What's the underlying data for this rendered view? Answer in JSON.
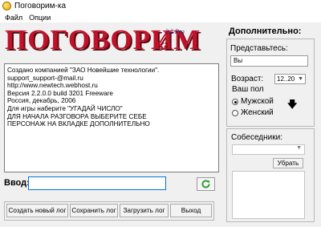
{
  "window": {
    "title": "Поговорим-ка"
  },
  "menu": {
    "items": [
      "Файл",
      "Опции"
    ]
  },
  "logo": {
    "main": "ПОГОВОРИМ",
    "suffix": "ка",
    "version": "2.2 Pro"
  },
  "chat": {
    "text": "Создано компанией \"ЗАО Новейшие технологии\".\nsupport_support-@mail.ru\nhttp://www.newtech.webhost.ru\nВерсия 2.2.0.0 build 3201 Freeware\nРоссия, декабрь, 2006\nДля игры наберите \"УГАДАЙ ЧИСЛО\"\nДЛЯ НАЧАЛА РАЗГОВОРА ВЫБЕРИТЕ СЕБЕ\nПЕРСОНАЖ НА ВКЛАДКЕ ДОПОЛНИТЕЛЬНО"
  },
  "input": {
    "label": "Ввод:",
    "value": ""
  },
  "buttons": {
    "new_log": "Создать новый лог",
    "save_log": "Сохранить лог",
    "load_log": "Загрузить лог",
    "exit": "Выход"
  },
  "extra": {
    "title": "Дополнительно:",
    "intro_label": "Представьтесь:",
    "name_value": "Вы",
    "age_label": "Возраст:",
    "age_value": "12..20",
    "gender_label": "Ваш пол",
    "gender_options": [
      "Мужской",
      "Женский"
    ],
    "gender_selected": "Мужской"
  },
  "partners": {
    "title": "Собеседники:",
    "selected": "",
    "remove_label": "Убрать"
  },
  "colors": {
    "logo_red": "#c0122a",
    "refresh_green": "#2f9a2f"
  },
  "icons": {
    "refresh": "refresh-icon",
    "app": "app-icon",
    "down": "down-arrow-icon"
  }
}
